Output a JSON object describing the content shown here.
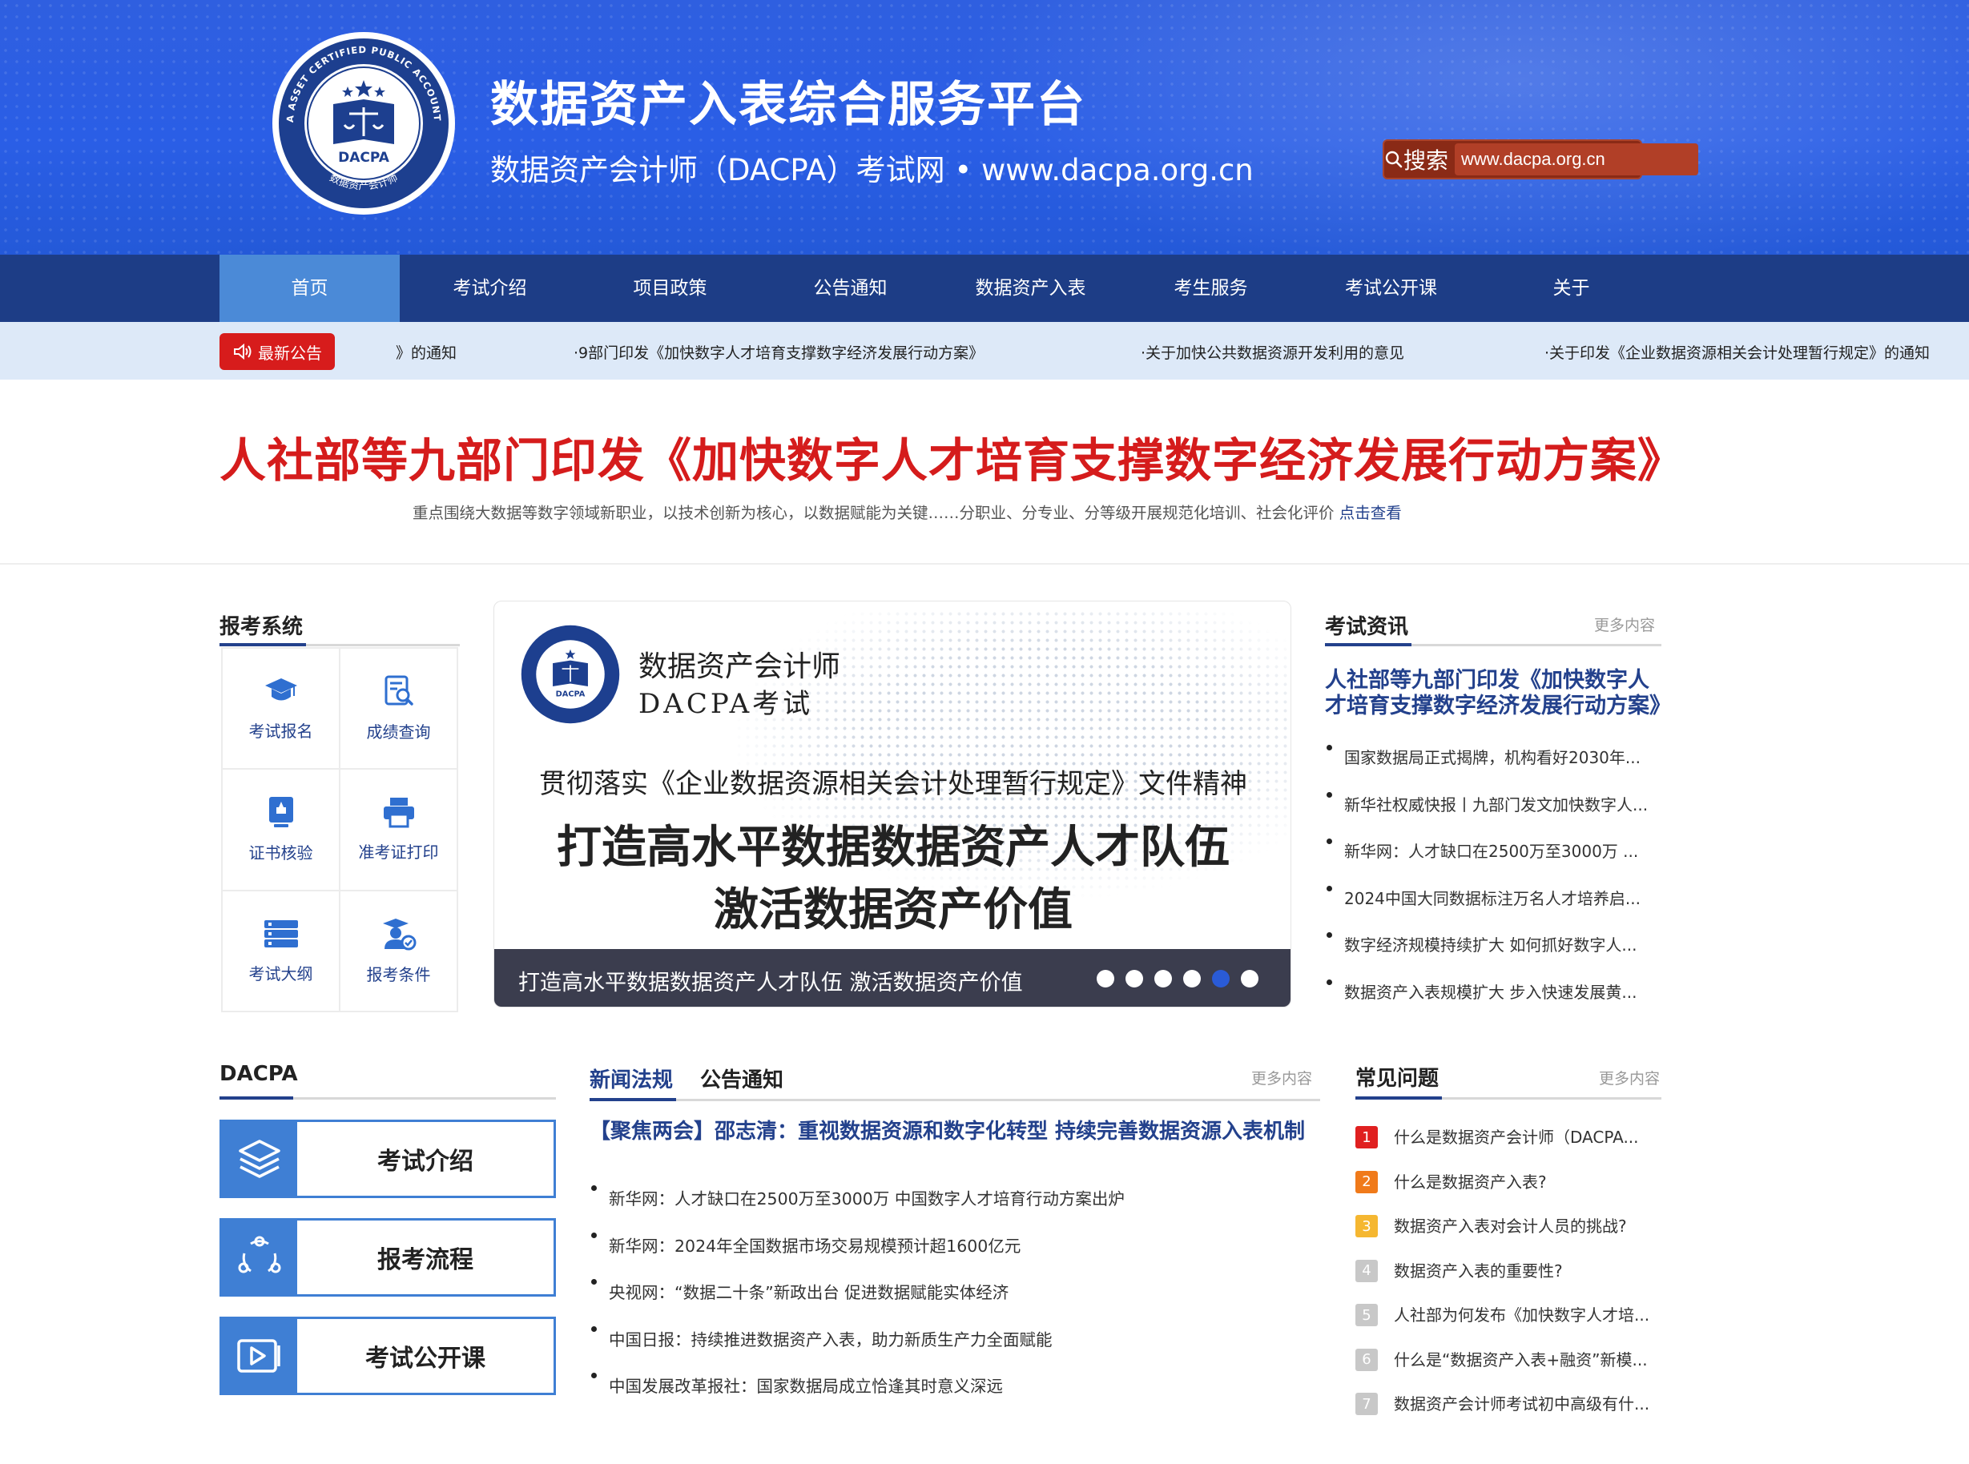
{
  "header": {
    "title": "数据资产入表综合服务平台",
    "subtitle": "数据资产会计师（DACPA）考试网 • www.dacpa.org.cn",
    "logo_text_ring": "DATA ASSET CERTIFIED PUBLIC ACCOUNTANT",
    "logo_text_center": "DACPA",
    "logo_text_bottom": "数据资产会计师",
    "search_label": "搜索",
    "search_placeholder": "www.dacpa.org.cn",
    "search_color": "#8a2a16"
  },
  "nav": {
    "items": [
      "首页",
      "考试介绍",
      "项目政策",
      "公告通知",
      "数据资产入表",
      "考生服务",
      "考试公开课",
      "关于"
    ],
    "active_color": "#4b8ad7"
  },
  "ticker": {
    "badge": "最新公告",
    "items": [
      "》的通知",
      "·9部门印发《加快数字人才培育支撑数字经济发展行动方案》",
      "·关于加快公共数据资源开发利用的意见",
      "·关于印发《企业数据资源相关会计处理暂行规定》的通知"
    ]
  },
  "headline": {
    "title": "人社部等九部门印发《加快数字人才培育支撑数字经济发展行动方案》",
    "summary": "重点围绕大数据等数字领域新职业，以技术创新为核心，以数据赋能为关键……分职业、分专业、分等级开展规范化培训、社会化评价",
    "more": "点击查看"
  },
  "exam_system": {
    "title": "报考系统",
    "items": [
      {
        "label": "考试报名",
        "icon": "graduation-cap-icon"
      },
      {
        "label": "成绩查询",
        "icon": "score-search-icon"
      },
      {
        "label": "证书核验",
        "icon": "certificate-icon"
      },
      {
        "label": "准考证打印",
        "icon": "printer-icon"
      },
      {
        "label": "考试大纲",
        "icon": "syllabus-icon"
      },
      {
        "label": "报考条件",
        "icon": "candidate-icon"
      }
    ]
  },
  "banner": {
    "brand_line1": "数据资产会计师",
    "brand_line2": "DACPA考试",
    "subtitle": "贯彻落实《企业数据资源相关会计处理暂行规定》文件精神",
    "headline1": "打造高水平数据数据资产人才队伍",
    "headline2": "激活数据资产价值",
    "caption": "打造高水平数据数据资产人才队伍 激活数据资产价值",
    "slide_count": 6,
    "active_slide": 5
  },
  "exam_news": {
    "title": "考试资讯",
    "more": "更多内容",
    "feature": "人社部等九部门印发《加快数字人才培育支撑数字经济发展行动方案》",
    "items": [
      "国家数据局正式揭牌，机构看好2030年...",
      "新华社权威快报丨九部门发文加快数字人...",
      "新华网：人才缺口在2500万至3000万 ...",
      "2024中国大同数据标注万名人才培养启...",
      "数字经济规模持续扩大 如何抓好数字人...",
      "数据资产入表规模扩大 步入快速发展黄..."
    ]
  },
  "dacpa": {
    "title": "DACPA",
    "buttons": [
      {
        "label": "考试介绍",
        "icon": "layers-icon"
      },
      {
        "label": "报考流程",
        "icon": "cycle-icon"
      },
      {
        "label": "考试公开课",
        "icon": "video-play-icon"
      }
    ]
  },
  "news": {
    "tab_active": "新闻法规",
    "tab_inactive": "公告通知",
    "more": "更多内容",
    "feature": "【聚焦两会】邵志清：重视数据资源和数字化转型 持续完善数据资源入表机制",
    "items": [
      "新华网：人才缺口在2500万至3000万 中国数字人才培育行动方案出炉",
      "新华网：2024年全国数据市场交易规模预计超1600亿元",
      "央视网：“数据二十条”新政出台 促进数据赋能实体经济",
      "中国日报：持续推进数据资产入表，助力新质生产力全面赋能",
      "中国发展改革报社：国家数据局成立恰逢其时意义深远"
    ]
  },
  "faq": {
    "title": "常见问题",
    "more": "更多内容",
    "items": [
      {
        "num": "1",
        "q": "什么是数据资产会计师（DACPA...",
        "color": "#e02020"
      },
      {
        "num": "2",
        "q": "什么是数据资产入表?",
        "color": "#f07a1a"
      },
      {
        "num": "3",
        "q": "数据资产入表对会计人员的挑战?",
        "color": "#f5b731"
      },
      {
        "num": "4",
        "q": "数据资产入表的重要性?",
        "color": "#c8c8c8"
      },
      {
        "num": "5",
        "q": "人社部为何发布《加快数字人才培...",
        "color": "#c8c8c8"
      },
      {
        "num": "6",
        "q": "什么是“数据资产入表+融资”新模...",
        "color": "#c8c8c8"
      },
      {
        "num": "7",
        "q": "数据资产会计师考试初中高级有什...",
        "color": "#c8c8c8"
      }
    ]
  },
  "colors": {
    "header_blue": "#2f5fe0",
    "nav_navy": "#1d3d86",
    "ticker_bg": "#dde9f8",
    "accent_red": "#d51c1c",
    "link_blue": "#23418c",
    "icon_blue": "#3f7fd4"
  }
}
